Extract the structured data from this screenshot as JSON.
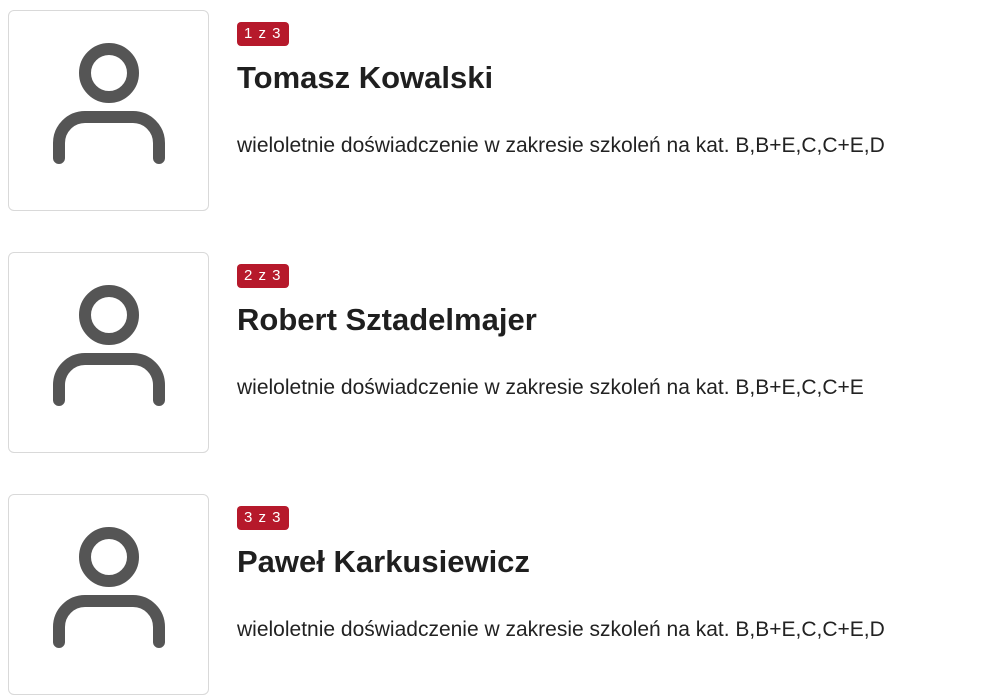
{
  "instructors": [
    {
      "counter": "1 z 3",
      "name": "Tomasz Kowalski",
      "description": "wieloletnie doświadczenie w zakresie szkoleń na kat. B,B+E,C,C+E,D",
      "photo_icon": "user-icon"
    },
    {
      "counter": "2 z 3",
      "name": "Robert Sztadelmajer",
      "description": "wieloletnie doświadczenie w zakresie szkoleń na kat. B,B+E,C,C+E",
      "photo_icon": "user-icon"
    },
    {
      "counter": "3 z 3",
      "name": "Paweł Karkusiewicz",
      "description": "wieloletnie doświadczenie w zakresie szkoleń na kat. B,B+E,C,C+E,D",
      "photo_icon": "user-icon"
    }
  ],
  "colors": {
    "badge_background": "#b6192b",
    "badge_text": "#ffffff",
    "icon": "#555555",
    "card_border": "#d9d9d9"
  }
}
